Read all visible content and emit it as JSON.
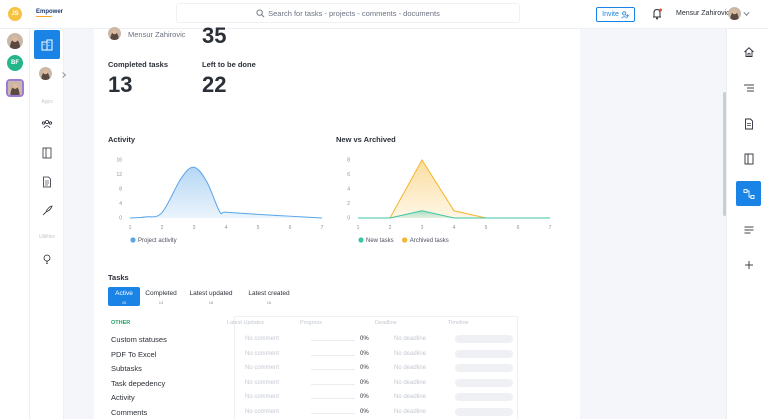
{
  "topbar": {
    "logo_initials": "JS",
    "logo_text": "Empower",
    "search_placeholder": "Search for tasks - projects - comments - documents",
    "invite_label": "Invite",
    "user_name": "Mensur Zahirovic"
  },
  "workspaces": [
    {
      "type": "photo"
    },
    {
      "type": "initials",
      "label": "BF"
    },
    {
      "type": "photo",
      "selected": true
    }
  ],
  "sidebar": {
    "label_apps": "Apps",
    "label_utilities": "Utilities"
  },
  "dashboard": {
    "manager_name": "Mensur Zahirovic",
    "top_value": "35",
    "completed_label": "Completed tasks",
    "completed_value": "13",
    "left_label": "Left to be done",
    "left_value": "22"
  },
  "chart_data": [
    {
      "type": "area",
      "title": "Activity",
      "x": [
        1,
        2,
        3,
        4,
        5,
        6,
        7
      ],
      "ylim": [
        0,
        16
      ],
      "yticks": [
        0,
        4,
        8,
        12,
        16
      ],
      "series": [
        {
          "name": "Project activity",
          "color": "#5aa5e8",
          "points": [
            [
              1,
              0
            ],
            [
              1.5,
              0.3
            ],
            [
              2,
              1.5
            ],
            [
              2.6,
              11
            ],
            [
              3,
              14
            ],
            [
              3.4,
              10
            ],
            [
              3.8,
              1.8
            ],
            [
              4,
              1.6
            ],
            [
              5,
              1
            ],
            [
              6,
              0.5
            ],
            [
              7,
              0
            ]
          ]
        }
      ]
    },
    {
      "type": "area",
      "title": "New vs Archived",
      "x": [
        1,
        2,
        3,
        4,
        5,
        6,
        7
      ],
      "ylim": [
        0,
        8
      ],
      "yticks": [
        0,
        2,
        4,
        6,
        8
      ],
      "series": [
        {
          "name": "New tasks",
          "color": "#3cc4a8",
          "points": [
            [
              1,
              0
            ],
            [
              2,
              0
            ],
            [
              3,
              1
            ],
            [
              4,
              0
            ],
            [
              5,
              0
            ],
            [
              6,
              0
            ],
            [
              7,
              0
            ]
          ]
        },
        {
          "name": "Archived tasks",
          "color": "#f5b42a",
          "points": [
            [
              1,
              0
            ],
            [
              2,
              0
            ],
            [
              3,
              8
            ],
            [
              4,
              1
            ],
            [
              5,
              0
            ],
            [
              6,
              0
            ],
            [
              7,
              0
            ]
          ]
        }
      ]
    }
  ],
  "tasks": {
    "title": "Tasks",
    "tabs": [
      {
        "label": "Active",
        "count": "26",
        "active": true
      },
      {
        "label": "Completed",
        "count": "13"
      },
      {
        "label": "Latest updated",
        "count": "18"
      },
      {
        "label": "Latest created",
        "count": "16"
      }
    ],
    "headers": {
      "group": "OTHER",
      "latest_update": "Latest Updates",
      "progress": "Progress",
      "deadline": "Deadline",
      "timeline": "Timeline"
    },
    "rows": [
      {
        "name": "Custom statuses",
        "comment": "No comment",
        "progress": "0%",
        "deadline": "No deadline"
      },
      {
        "name": "PDF To Excel",
        "comment": "No comment",
        "progress": "0%",
        "deadline": "No deadline"
      },
      {
        "name": "Subtasks",
        "comment": "No comment",
        "progress": "0%",
        "deadline": "No deadline"
      },
      {
        "name": "Task depedency",
        "comment": "No comment",
        "progress": "0%",
        "deadline": "No deadline"
      },
      {
        "name": "Activity",
        "comment": "No comment",
        "progress": "0%",
        "deadline": "No deadline"
      },
      {
        "name": "Comments",
        "comment": "No comment",
        "progress": "0%",
        "deadline": "No deadline"
      }
    ]
  },
  "colors": {
    "accent": "#1a84e6",
    "group_green": "#25a065"
  }
}
